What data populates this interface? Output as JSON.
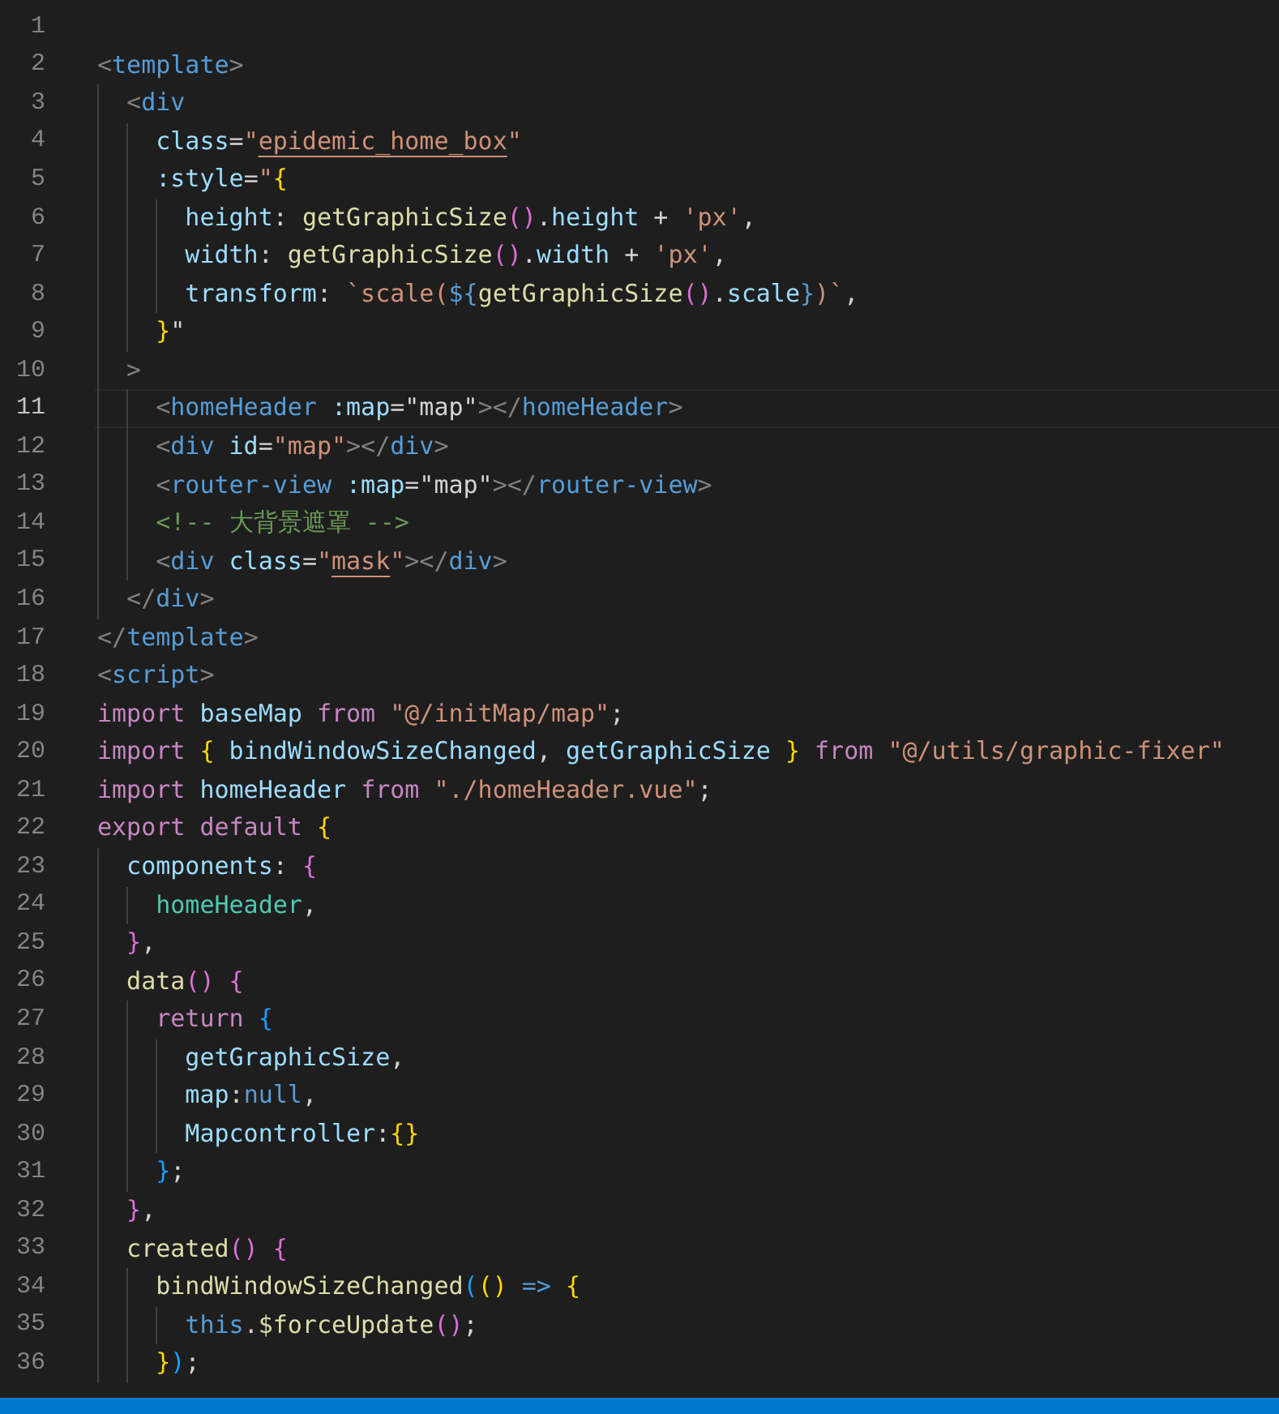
{
  "editor": {
    "lines": [
      {
        "number": "1",
        "current": false
      },
      {
        "number": "2",
        "current": false,
        "tokens": [
          {
            "kind": "p",
            "text": "<"
          },
          {
            "kind": "tag",
            "text": "template"
          },
          {
            "kind": "p",
            "text": ">"
          }
        ]
      },
      {
        "number": "3",
        "current": false,
        "tokens": [
          {
            "kind": "p",
            "text": "  <"
          },
          {
            "kind": "tag",
            "text": "div"
          }
        ]
      },
      {
        "number": "4",
        "current": false,
        "tokens": [
          {
            "kind": "attr",
            "text": "    class"
          },
          {
            "kind": "plain",
            "text": "="
          },
          {
            "kind": "str",
            "text": "\""
          },
          {
            "kind": "under",
            "text": "epidemic_home_box"
          },
          {
            "kind": "str",
            "text": "\""
          }
        ]
      },
      {
        "number": "5",
        "current": false,
        "tokens": [
          {
            "kind": "attr",
            "text": "    :style"
          },
          {
            "kind": "plain",
            "text": "="
          },
          {
            "kind": "str",
            "text": "\""
          },
          {
            "kind": "b1",
            "text": "{"
          }
        ]
      },
      {
        "number": "6",
        "current": false,
        "tokens": [
          {
            "kind": "var",
            "text": "      height"
          },
          {
            "kind": "plain",
            "text": ": "
          },
          {
            "kind": "fn",
            "text": "getGraphicSize"
          },
          {
            "kind": "b2",
            "text": "()"
          },
          {
            "kind": "plain",
            "text": "."
          },
          {
            "kind": "var",
            "text": "height"
          },
          {
            "kind": "plain",
            "text": " + "
          },
          {
            "kind": "str",
            "text": "'px'"
          },
          {
            "kind": "plain",
            "text": ","
          }
        ]
      },
      {
        "number": "7",
        "current": false,
        "tokens": [
          {
            "kind": "var",
            "text": "      width"
          },
          {
            "kind": "plain",
            "text": ": "
          },
          {
            "kind": "fn",
            "text": "getGraphicSize"
          },
          {
            "kind": "b2",
            "text": "()"
          },
          {
            "kind": "plain",
            "text": "."
          },
          {
            "kind": "var",
            "text": "width"
          },
          {
            "kind": "plain",
            "text": " + "
          },
          {
            "kind": "str",
            "text": "'px'"
          },
          {
            "kind": "plain",
            "text": ","
          }
        ]
      },
      {
        "number": "8",
        "current": false,
        "tokens": [
          {
            "kind": "var",
            "text": "      transform"
          },
          {
            "kind": "plain",
            "text": ": "
          },
          {
            "kind": "str",
            "text": "`scale("
          },
          {
            "kind": "blue",
            "text": "${"
          },
          {
            "kind": "fn",
            "text": "getGraphicSize"
          },
          {
            "kind": "b2",
            "text": "()"
          },
          {
            "kind": "plain",
            "text": "."
          },
          {
            "kind": "var",
            "text": "scale"
          },
          {
            "kind": "blue",
            "text": "}"
          },
          {
            "kind": "str",
            "text": ")`"
          },
          {
            "kind": "plain",
            "text": ","
          }
        ]
      },
      {
        "number": "9",
        "current": false,
        "tokens": [
          {
            "kind": "b1",
            "text": "    }"
          },
          {
            "kind": "plain",
            "text": "\""
          }
        ]
      },
      {
        "number": "10",
        "current": false,
        "tokens": [
          {
            "kind": "p",
            "text": "  >"
          }
        ]
      },
      {
        "number": "11",
        "current": true,
        "tokens": [
          {
            "kind": "p",
            "text": "    <"
          },
          {
            "kind": "tag",
            "text": "homeHeader "
          },
          {
            "kind": "attr",
            "text": ":map"
          },
          {
            "kind": "plain",
            "text": "=\"map\""
          },
          {
            "kind": "p",
            "text": "></"
          },
          {
            "kind": "tag",
            "text": "homeHeader"
          },
          {
            "kind": "p",
            "text": ">"
          }
        ]
      },
      {
        "number": "12",
        "current": false,
        "tokens": [
          {
            "kind": "p",
            "text": "    <"
          },
          {
            "kind": "tag",
            "text": "div "
          },
          {
            "kind": "attr",
            "text": "id"
          },
          {
            "kind": "plain",
            "text": "="
          },
          {
            "kind": "str",
            "text": "\"map\""
          },
          {
            "kind": "p",
            "text": "></"
          },
          {
            "kind": "tag",
            "text": "div"
          },
          {
            "kind": "p",
            "text": ">"
          }
        ]
      },
      {
        "number": "13",
        "current": false,
        "tokens": [
          {
            "kind": "p",
            "text": "    <"
          },
          {
            "kind": "tag",
            "text": "router-view "
          },
          {
            "kind": "attr",
            "text": ":map"
          },
          {
            "kind": "plain",
            "text": "=\"map\""
          },
          {
            "kind": "p",
            "text": "></"
          },
          {
            "kind": "tag",
            "text": "router-view"
          },
          {
            "kind": "p",
            "text": ">"
          }
        ]
      },
      {
        "number": "14",
        "current": false,
        "tokens": [
          {
            "kind": "cmt",
            "text": "    <!-- 大背景遮罩 -->"
          }
        ]
      },
      {
        "number": "15",
        "current": false,
        "tokens": [
          {
            "kind": "p",
            "text": "    <"
          },
          {
            "kind": "tag",
            "text": "div "
          },
          {
            "kind": "attr",
            "text": "class"
          },
          {
            "kind": "plain",
            "text": "="
          },
          {
            "kind": "str",
            "text": "\""
          },
          {
            "kind": "under",
            "text": "mask"
          },
          {
            "kind": "str",
            "text": "\""
          },
          {
            "kind": "p",
            "text": "></"
          },
          {
            "kind": "tag",
            "text": "div"
          },
          {
            "kind": "p",
            "text": ">"
          }
        ]
      },
      {
        "number": "16",
        "current": false,
        "tokens": [
          {
            "kind": "p",
            "text": "  </"
          },
          {
            "kind": "tag",
            "text": "div"
          },
          {
            "kind": "p",
            "text": ">"
          }
        ]
      },
      {
        "number": "17",
        "current": false,
        "tokens": [
          {
            "kind": "p",
            "text": "</"
          },
          {
            "kind": "tag",
            "text": "template"
          },
          {
            "kind": "p",
            "text": ">"
          }
        ]
      },
      {
        "number": "18",
        "current": false,
        "tokens": [
          {
            "kind": "p",
            "text": "<"
          },
          {
            "kind": "tag",
            "text": "script"
          },
          {
            "kind": "p",
            "text": ">"
          }
        ]
      },
      {
        "number": "19",
        "current": false,
        "tokens": [
          {
            "kind": "kw",
            "text": "import "
          },
          {
            "kind": "var",
            "text": "baseMap "
          },
          {
            "kind": "kw",
            "text": "from "
          },
          {
            "kind": "str",
            "text": "\"@/initMap/map\""
          },
          {
            "kind": "plain",
            "text": ";"
          }
        ]
      },
      {
        "number": "20",
        "current": false,
        "tokens": [
          {
            "kind": "kw",
            "text": "import "
          },
          {
            "kind": "b1",
            "text": "{"
          },
          {
            "kind": "var",
            "text": " bindWindowSizeChanged"
          },
          {
            "kind": "plain",
            "text": ", "
          },
          {
            "kind": "var",
            "text": "getGraphicSize "
          },
          {
            "kind": "b1",
            "text": "} "
          },
          {
            "kind": "kw",
            "text": "from "
          },
          {
            "kind": "str",
            "text": "\"@/utils/graphic-fixer\""
          }
        ]
      },
      {
        "number": "21",
        "current": false,
        "tokens": [
          {
            "kind": "kw",
            "text": "import "
          },
          {
            "kind": "var",
            "text": "homeHeader "
          },
          {
            "kind": "kw",
            "text": "from "
          },
          {
            "kind": "str",
            "text": "\"./homeHeader.vue\""
          },
          {
            "kind": "plain",
            "text": ";"
          }
        ]
      },
      {
        "number": "22",
        "current": false,
        "tokens": [
          {
            "kind": "kw",
            "text": "export default "
          },
          {
            "kind": "b1",
            "text": "{"
          }
        ]
      },
      {
        "number": "23",
        "current": false,
        "tokens": [
          {
            "kind": "var",
            "text": "  components"
          },
          {
            "kind": "plain",
            "text": ": "
          },
          {
            "kind": "b2",
            "text": "{"
          }
        ]
      },
      {
        "number": "24",
        "current": false,
        "tokens": [
          {
            "kind": "comp",
            "text": "    homeHeader"
          },
          {
            "kind": "plain",
            "text": ","
          }
        ]
      },
      {
        "number": "25",
        "current": false,
        "tokens": [
          {
            "kind": "b2",
            "text": "  }"
          },
          {
            "kind": "plain",
            "text": ","
          }
        ]
      },
      {
        "number": "26",
        "current": false,
        "tokens": [
          {
            "kind": "fn",
            "text": "  data"
          },
          {
            "kind": "b2",
            "text": "() {"
          }
        ]
      },
      {
        "number": "27",
        "current": false,
        "tokens": [
          {
            "kind": "kw",
            "text": "    return "
          },
          {
            "kind": "b3",
            "text": "{"
          }
        ]
      },
      {
        "number": "28",
        "current": false,
        "tokens": [
          {
            "kind": "var",
            "text": "      getGraphicSize"
          },
          {
            "kind": "plain",
            "text": ","
          }
        ]
      },
      {
        "number": "29",
        "current": false,
        "tokens": [
          {
            "kind": "var",
            "text": "      map"
          },
          {
            "kind": "plain",
            "text": ":"
          },
          {
            "kind": "blue",
            "text": "null"
          },
          {
            "kind": "plain",
            "text": ","
          }
        ]
      },
      {
        "number": "30",
        "current": false,
        "tokens": [
          {
            "kind": "var",
            "text": "      Mapcontroller"
          },
          {
            "kind": "plain",
            "text": ":"
          },
          {
            "kind": "b1",
            "text": "{}"
          }
        ]
      },
      {
        "number": "31",
        "current": false,
        "tokens": [
          {
            "kind": "b3",
            "text": "    }"
          },
          {
            "kind": "plain",
            "text": ";"
          }
        ]
      },
      {
        "number": "32",
        "current": false,
        "tokens": [
          {
            "kind": "b2",
            "text": "  }"
          },
          {
            "kind": "plain",
            "text": ","
          }
        ]
      },
      {
        "number": "33",
        "current": false,
        "tokens": [
          {
            "kind": "fn",
            "text": "  created"
          },
          {
            "kind": "b2",
            "text": "() {"
          }
        ]
      },
      {
        "number": "34",
        "current": false,
        "tokens": [
          {
            "kind": "fn",
            "text": "    bindWindowSizeChanged"
          },
          {
            "kind": "b3",
            "text": "("
          },
          {
            "kind": "b1",
            "text": "() "
          },
          {
            "kind": "blue",
            "text": "=> "
          },
          {
            "kind": "b1",
            "text": "{"
          }
        ]
      },
      {
        "number": "35",
        "current": false,
        "tokens": [
          {
            "kind": "blue",
            "text": "      this"
          },
          {
            "kind": "plain",
            "text": "."
          },
          {
            "kind": "fn",
            "text": "$forceUpdate"
          },
          {
            "kind": "b2",
            "text": "()"
          },
          {
            "kind": "plain",
            "text": ";"
          }
        ]
      },
      {
        "number": "36",
        "current": false,
        "tokens": [
          {
            "kind": "b1",
            "text": "    }"
          },
          {
            "kind": "b3",
            "text": ")"
          },
          {
            "kind": "plain",
            "text": ";"
          }
        ]
      }
    ]
  }
}
